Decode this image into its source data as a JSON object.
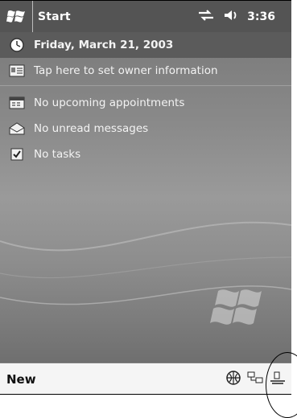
{
  "titlebar": {
    "app_title": "Start",
    "time": "3:36",
    "icons": [
      "windows-flag-icon",
      "connectivity-icon",
      "speaker-icon"
    ]
  },
  "today": {
    "date": "Friday, March 21, 2003",
    "owner": "Tap here to set owner information",
    "appointments": "No upcoming appointments",
    "messages": "No unread messages",
    "tasks": "No tasks",
    "icons": [
      "clock-icon",
      "owner-card-icon",
      "calendar-icon",
      "inbox-icon",
      "tasks-icon"
    ]
  },
  "bottom": {
    "new_label": "New",
    "icons": [
      "globe-icon",
      "network-icon",
      "activesync-icon"
    ]
  },
  "colors": {
    "title_bg": "#545454",
    "today_bg": "#8a8a8a",
    "bottom_bg": "#f5f5f5"
  }
}
